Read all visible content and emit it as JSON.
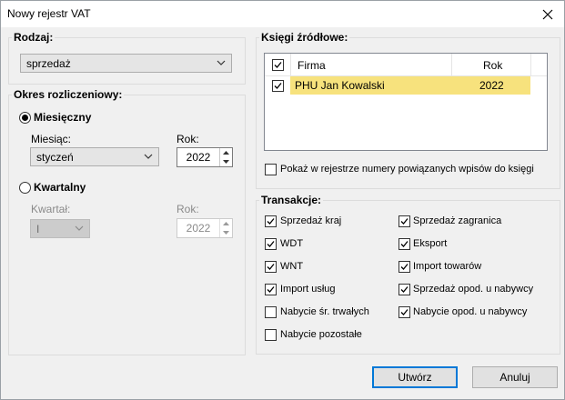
{
  "window": {
    "title": "Nowy rejestr VAT"
  },
  "rodzaj": {
    "legend": "Rodzaj:",
    "selected": "sprzedaż"
  },
  "okres": {
    "legend": "Okres rozliczeniowy:",
    "monthly": {
      "label": "Miesięczny",
      "selected": true,
      "month_label": "Miesiąc:",
      "month_value": "styczeń",
      "year_label": "Rok:",
      "year_value": "2022"
    },
    "quarterly": {
      "label": "Kwartalny",
      "selected": false,
      "quarter_label": "Kwartał:",
      "quarter_value": "I",
      "year_label": "Rok:",
      "year_value": "2022"
    }
  },
  "ksiegi": {
    "legend": "Księgi źródłowe:",
    "columns": [
      "Firma",
      "Rok"
    ],
    "rows": [
      {
        "checked": true,
        "firma": "PHU Jan Kowalski",
        "rok": "2022"
      }
    ],
    "show_numbers": {
      "label": "Pokaż w rejestrze numery powiązanych wpisów do księgi",
      "checked": false
    }
  },
  "transakcje": {
    "legend": "Transakcje:",
    "items": [
      {
        "label": "Sprzedaż kraj",
        "checked": true
      },
      {
        "label": "Sprzedaż zagranica",
        "checked": true
      },
      {
        "label": "WDT",
        "checked": true
      },
      {
        "label": "Eksport",
        "checked": true
      },
      {
        "label": "WNT",
        "checked": true
      },
      {
        "label": "Import towarów",
        "checked": true
      },
      {
        "label": "Import usług",
        "checked": true
      },
      {
        "label": "Sprzedaż opod. u nabywcy",
        "checked": true
      },
      {
        "label": "Nabycie śr. trwałych",
        "checked": false
      },
      {
        "label": "Nabycie opod. u nabywcy",
        "checked": true
      },
      {
        "label": "Nabycie pozostałe",
        "checked": false
      }
    ]
  },
  "buttons": {
    "create": "Utwórz",
    "cancel": "Anuluj"
  },
  "colors": {
    "selected_row": "#f7e27d",
    "default_button_border": "#0078d7"
  }
}
